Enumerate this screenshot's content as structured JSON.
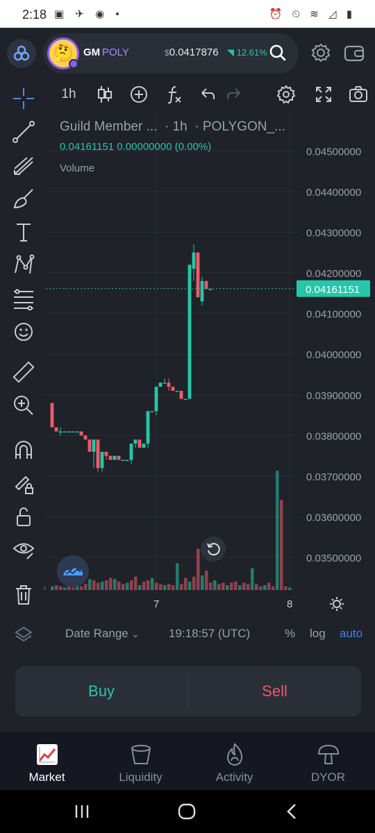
{
  "status_bar": {
    "time": "2:18",
    "left_icons": "▣ ✈ ◉ •",
    "right_icons": "⏰ ⏲ ≋ ◿ ▮"
  },
  "header": {
    "token_symbol": "GM",
    "token_network": "POLY",
    "price_currency": "$",
    "price": "0.0417876",
    "change": "12.61%",
    "avatar_icon": "thinking-face",
    "colors": {
      "accent": "#8b5cf6",
      "up": "#26c6a8",
      "down": "#ef5b6b"
    }
  },
  "chart_toolbar": {
    "interval": "1h"
  },
  "legend": {
    "pair": "Guild Member ...",
    "interval": "1h",
    "exchange": "POLYGON_...",
    "ohlc": "0.04161151  0.00000000 (0.00%)",
    "volume_label": "Volume"
  },
  "bottom_bar": {
    "date_range": "Date Range",
    "clock": "19:18:57 (UTC)",
    "percent": "%",
    "log": "log",
    "auto": "auto"
  },
  "trade": {
    "buy": "Buy",
    "sell": "Sell"
  },
  "nav": {
    "items": [
      "Market",
      "Liquidity",
      "Activity",
      "DYOR"
    ],
    "active": "Market"
  },
  "chart_data": {
    "type": "candlestick",
    "interval": "1h",
    "y_ticks": [
      "0.04500000",
      "0.04400000",
      "0.04300000",
      "0.04200000",
      "0.04100000",
      "0.04000000",
      "0.03900000",
      "0.03800000",
      "0.03700000",
      "0.03600000",
      "0.03500000"
    ],
    "ylim": [
      0.0342,
      0.0455
    ],
    "x_ticks": [
      {
        "label": "7",
        "index": 25
      },
      {
        "label": "8",
        "index": 57
      }
    ],
    "last_price": "0.04161151",
    "candles": [
      [
        0.0388,
        0.0388,
        0.0382,
        0.0382
      ],
      [
        0.0382,
        0.0382,
        0.0381,
        0.0381
      ],
      [
        0.0381,
        0.0382,
        0.038,
        0.0381
      ],
      [
        0.0381,
        0.0381,
        0.0381,
        0.0381
      ],
      [
        0.0381,
        0.0381,
        0.0381,
        0.0381
      ],
      [
        0.0381,
        0.0381,
        0.0381,
        0.0381
      ],
      [
        0.0381,
        0.0381,
        0.0381,
        0.0381
      ],
      [
        0.0381,
        0.0381,
        0.038,
        0.038
      ],
      [
        0.038,
        0.038,
        0.0379,
        0.0379
      ],
      [
        0.0379,
        0.0379,
        0.0376,
        0.0376
      ],
      [
        0.0376,
        0.0379,
        0.0372,
        0.0379
      ],
      [
        0.0379,
        0.0379,
        0.0371,
        0.0372
      ],
      [
        0.0372,
        0.0376,
        0.0371,
        0.0376
      ],
      [
        0.0376,
        0.0376,
        0.0374,
        0.0375
      ],
      [
        0.0375,
        0.0375,
        0.0374,
        0.0374
      ],
      [
        0.0374,
        0.0375,
        0.0374,
        0.0375
      ],
      [
        0.0375,
        0.0375,
        0.0374,
        0.0374
      ],
      [
        0.0374,
        0.0374,
        0.0374,
        0.0374
      ],
      [
        0.0374,
        0.0374,
        0.0374,
        0.0374
      ],
      [
        0.0374,
        0.0378,
        0.0373,
        0.0378
      ],
      [
        0.0378,
        0.0379,
        0.0377,
        0.0379
      ],
      [
        0.0379,
        0.0379,
        0.0377,
        0.0377
      ],
      [
        0.0377,
        0.0378,
        0.0377,
        0.0378
      ],
      [
        0.0378,
        0.0386,
        0.0377,
        0.0386
      ],
      [
        0.0386,
        0.0386,
        0.0386,
        0.0386
      ],
      [
        0.0386,
        0.0392,
        0.0385,
        0.0392
      ],
      [
        0.0392,
        0.0393,
        0.0392,
        0.0393
      ],
      [
        0.0393,
        0.0394,
        0.0393,
        0.0393
      ],
      [
        0.0393,
        0.0394,
        0.0391,
        0.0392
      ],
      [
        0.0392,
        0.0392,
        0.0391,
        0.0391
      ],
      [
        0.0391,
        0.0391,
        0.0391,
        0.0391
      ],
      [
        0.0391,
        0.0391,
        0.0389,
        0.0389
      ],
      [
        0.0389,
        0.0389,
        0.0389,
        0.0389
      ],
      [
        0.0389,
        0.0422,
        0.0389,
        0.0422
      ],
      [
        0.0421,
        0.0427,
        0.0418,
        0.0425
      ],
      [
        0.0425,
        0.0425,
        0.0414,
        0.0414
      ],
      [
        0.0413,
        0.0419,
        0.0412,
        0.0418
      ],
      [
        0.0418,
        0.0418,
        0.0416,
        0.0416
      ],
      [
        0.0416,
        0.0416,
        0.0416,
        0.0416
      ]
    ],
    "volumes": [
      0.3,
      0.4,
      0.3,
      0.2,
      0.3,
      0.2,
      0.3,
      0.3,
      0.5,
      0.9,
      0.8,
      0.6,
      0.7,
      0.8,
      1.0,
      0.9,
      0.7,
      0.5,
      0.6,
      0.8,
      1.1,
      0.4,
      0.7,
      0.8,
      1.0,
      0.6,
      0.5,
      0.4,
      0.5,
      0.4,
      2.2,
      0.5,
      1.0,
      0.7,
      1.1,
      3.4,
      1.2,
      1.6,
      0.6,
      0.8,
      0.5,
      0.6,
      0.4,
      0.6,
      0.7,
      0.4,
      0.6,
      0.5,
      1.8,
      0.5,
      0.3,
      0.4,
      0.6,
      0.3,
      9.8,
      7.4,
      0.3,
      0.2
    ]
  }
}
